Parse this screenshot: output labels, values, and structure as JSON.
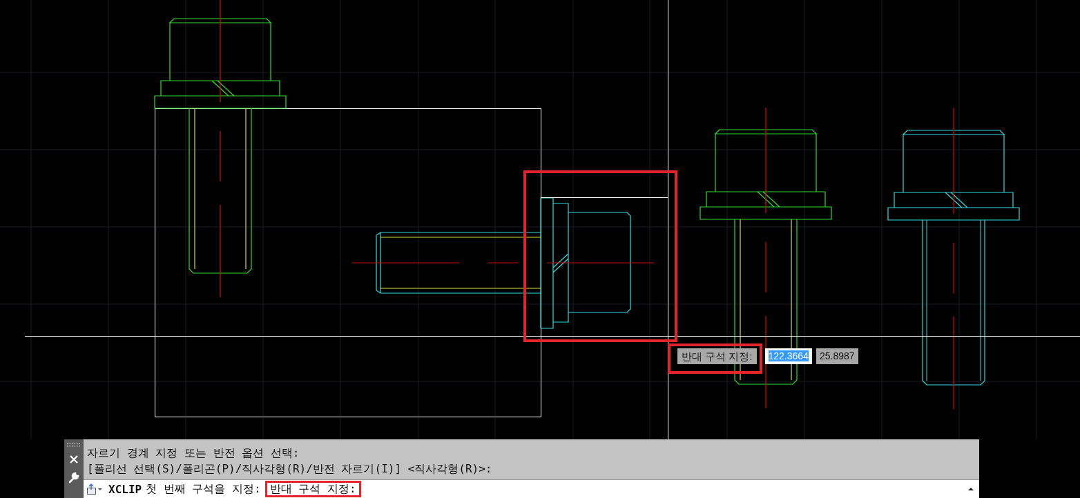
{
  "command_line": {
    "history": [
      "자르기 경계 지정 또는 반전 옵션 선택:",
      "[폴리선 선택(S)/폴리곤(P)/직사각형(R)/반전 자르기(I)] <직사각형(R)>:"
    ],
    "prompt": {
      "command": "XCLIP",
      "text": "첫 번째 구석을 지정:",
      "input": "반대 구석 지정:"
    }
  },
  "dynamic_input": {
    "prompt": "반대 구석 지정:",
    "fields": [
      {
        "value": "122.3664",
        "selected": true
      },
      {
        "value": "25.8987",
        "selected": false
      }
    ]
  }
}
